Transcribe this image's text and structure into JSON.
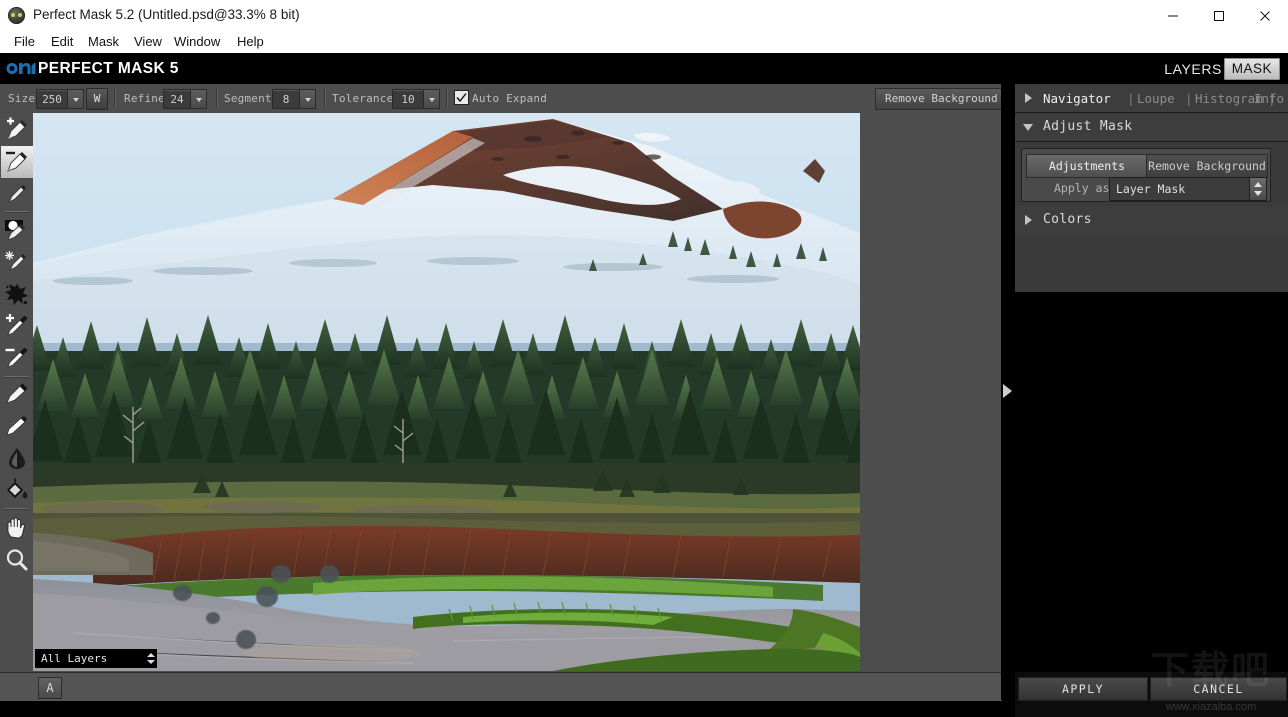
{
  "window": {
    "title": "Perfect Mask 5.2 (Untitled.psd@33.3% 8 bit)",
    "icon": "app-icon",
    "minimize": "minimize-icon",
    "maximize": "maximize-icon",
    "close": "close-icon"
  },
  "menubar": {
    "items": [
      {
        "label": "File"
      },
      {
        "label": "Edit"
      },
      {
        "label": "Mask"
      },
      {
        "label": "View"
      },
      {
        "label": "Window"
      },
      {
        "label": "Help"
      }
    ]
  },
  "appheader": {
    "logo": "on1-logo",
    "product": "PERFECT MASK 5",
    "tabs": [
      {
        "label": "LAYERS",
        "active": false
      },
      {
        "label": "MASK",
        "active": true
      }
    ]
  },
  "optionbar": {
    "size": {
      "label": "Size",
      "value": "250"
    },
    "width_toggle": "W",
    "refine": {
      "label": "Refine",
      "value": "24"
    },
    "segment": {
      "label": "Segment",
      "value": "8"
    },
    "tolerance": {
      "label": "Tolerance",
      "value": "10"
    },
    "auto_expand": {
      "label": "Auto Expand",
      "checked": true
    },
    "remove_background": "Remove Background"
  },
  "tools": [
    {
      "name": "perfect-brush-plus-tool",
      "icon": "brush-plus-icon",
      "active": false
    },
    {
      "name": "perfect-brush-minus-tool",
      "icon": "brush-minus-icon",
      "active": true
    },
    {
      "name": "refine-brush-tool",
      "icon": "small-brush-icon",
      "active": false
    },
    {
      "name": "magic-brush-tool",
      "icon": "magic-brush-icon",
      "active": false
    },
    {
      "name": "chisel-brush-tool",
      "icon": "sparkle-brush-icon",
      "active": false
    },
    {
      "name": "blur-brush-tool",
      "icon": "splatter-icon",
      "active": false
    },
    {
      "name": "drop-color-plus-tool",
      "icon": "eyedropper-plus-icon",
      "active": false
    },
    {
      "name": "drop-color-minus-tool",
      "icon": "eyedropper-minus-icon",
      "active": false
    },
    {
      "name": "keep-brush-tool",
      "icon": "marker-icon",
      "active": false
    },
    {
      "name": "drop-brush-tool",
      "icon": "knife-brush-icon",
      "active": false
    },
    {
      "name": "blur-tool",
      "icon": "droplet-icon",
      "active": false
    },
    {
      "name": "paint-bucket-tool",
      "icon": "paint-bucket-icon",
      "active": false
    },
    {
      "name": "pan-tool",
      "icon": "hand-icon",
      "active": false
    },
    {
      "name": "zoom-tool",
      "icon": "magnifier-icon",
      "active": false
    }
  ],
  "canvas": {
    "layers_select": {
      "value": "All Layers"
    },
    "collapse_arrow": "panel-collapse-arrow"
  },
  "bottombar": {
    "alpha_button": "A"
  },
  "right_panel": {
    "navigator_row": {
      "toggle": "expand-arrow",
      "links": [
        "Navigator",
        "Loupe",
        "Histogram",
        "Info"
      ],
      "active_index": 0
    },
    "adjust_mask": {
      "toggle": "collapse-arrow",
      "title": "Adjust Mask",
      "segmented": [
        {
          "label": "Adjustments",
          "selected": true
        },
        {
          "label": "Remove Background",
          "selected": false
        }
      ],
      "apply_as": {
        "label": "Apply as",
        "value": "Layer Mask"
      }
    },
    "colors": {
      "toggle": "expand-arrow",
      "title": "Colors"
    }
  },
  "footer": {
    "apply": "APPLY",
    "cancel": "CANCEL"
  },
  "watermark": {
    "cjk": "下载吧",
    "url": "www.xiazaiba.com"
  },
  "colors": {
    "accent_blue": "#1a6fb5",
    "chrome_gray": "#4d4d4d",
    "panel_gray": "#3a3a3a",
    "panel_header": "#3d3d3d",
    "black": "#000000"
  }
}
